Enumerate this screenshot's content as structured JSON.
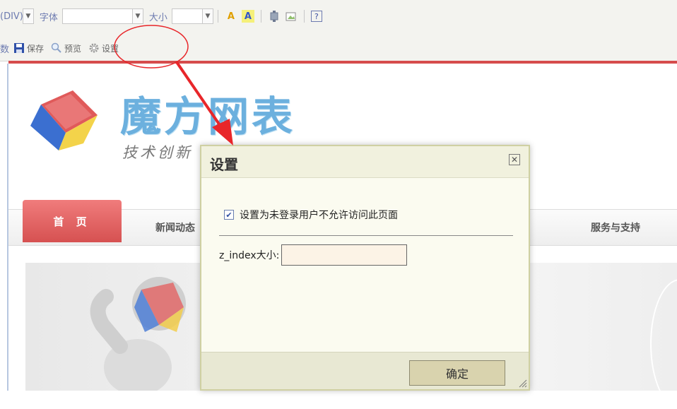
{
  "toolbar": {
    "row1": {
      "prefix_text": "(DIV)",
      "font_label": "字体",
      "font_value": "",
      "size_label": "大小",
      "size_value": ""
    },
    "row2": {
      "prefix_text": "数",
      "save_label": "保存",
      "preview_label": "预览",
      "settings_label": "设置"
    }
  },
  "page": {
    "logo_title": "魔方网表",
    "slogan": "技术创新",
    "nav": {
      "home": "首 页",
      "news": "新闻动态",
      "service": "服务与支持"
    }
  },
  "dialog": {
    "title": "设置",
    "close_icon": "close-icon",
    "checkbox_label": "设置为未登录用户不允许访问此页面",
    "checkbox_checked": true,
    "zindex_label": "z_index大小:",
    "zindex_value": "",
    "ok_label": "确定"
  },
  "colors": {
    "annotation_red": "#e8262a",
    "nav_home_bg": "#e06464",
    "dialog_bg": "#fbfbf0",
    "accent_blue": "#6cb0de"
  }
}
